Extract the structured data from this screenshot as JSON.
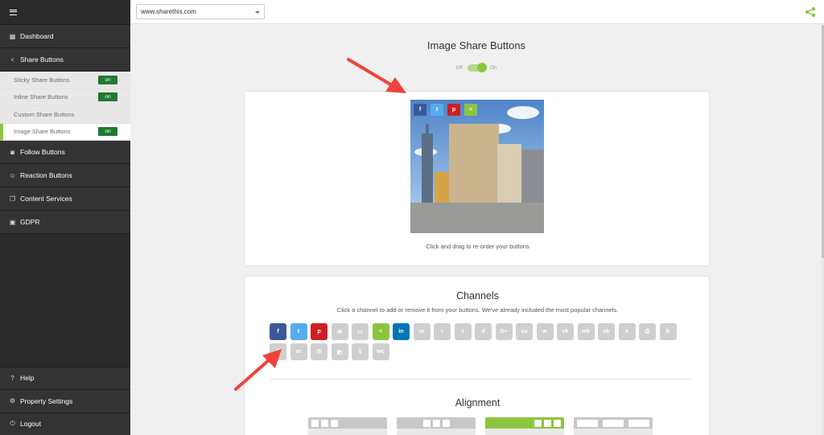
{
  "sidebar": {
    "menu_icon": "hamburger-icon",
    "items": [
      {
        "icon": "grid-icon",
        "label": "Dashboard"
      },
      {
        "icon": "share-icon",
        "label": "Share Buttons"
      }
    ],
    "sub_items": [
      {
        "label": "Sticky Share Buttons",
        "badge": "on"
      },
      {
        "label": "Inline Share Buttons",
        "badge": "on"
      },
      {
        "label": "Custom Share Buttons",
        "badge": ""
      },
      {
        "label": "Image Share Buttons",
        "badge": "on"
      }
    ],
    "items_after": [
      {
        "icon": "rss-icon",
        "label": "Follow Buttons"
      },
      {
        "icon": "smiley-icon",
        "label": "Reaction Buttons"
      },
      {
        "icon": "copy-icon",
        "label": "Content Services"
      },
      {
        "icon": "lock-icon",
        "label": "GDPR"
      }
    ],
    "bottom": [
      {
        "icon": "help-icon",
        "label": "Help"
      },
      {
        "icon": "gear-icon",
        "label": "Property Settings"
      },
      {
        "icon": "power-icon",
        "label": "Logout"
      }
    ]
  },
  "topbar": {
    "domain": "www.sharethis.com",
    "share_icon": "share-icon"
  },
  "main": {
    "title": "Image Share Buttons",
    "toggle": {
      "off_label": "Off",
      "on_label": "On",
      "state": "on"
    },
    "preview": {
      "buttons": [
        {
          "icon": "facebook-icon",
          "glyph": "f",
          "color": "#3b5998"
        },
        {
          "icon": "twitter-icon",
          "glyph": "t",
          "color": "#55acee"
        },
        {
          "icon": "pinterest-icon",
          "glyph": "p",
          "color": "#cb2027"
        },
        {
          "icon": "sharethis-icon",
          "glyph": "<",
          "color": "#8bc53f"
        }
      ],
      "caption": "Click and drag to re-order your buttons"
    },
    "channels": {
      "title": "Channels",
      "subtitle": "Click a channel to add or remove it from your buttons. We've already included the most popular channels.",
      "items": [
        {
          "icon": "facebook-icon",
          "glyph": "f",
          "color": "#3b5998",
          "selected": true
        },
        {
          "icon": "twitter-icon",
          "glyph": "t",
          "color": "#55acee",
          "selected": true
        },
        {
          "icon": "pinterest-icon",
          "glyph": "p",
          "color": "#cb2027",
          "selected": true
        },
        {
          "icon": "email-icon",
          "glyph": "✉",
          "color": "#cfcfcf",
          "selected": false
        },
        {
          "icon": "sms-icon",
          "glyph": "▭",
          "color": "#cfcfcf",
          "selected": false
        },
        {
          "icon": "sharethis-icon",
          "glyph": "<",
          "color": "#8bc53f",
          "selected": true
        },
        {
          "icon": "linkedin-icon",
          "glyph": "in",
          "color": "#0077b5",
          "selected": true
        },
        {
          "icon": "messenger-icon",
          "glyph": "m",
          "color": "#cfcfcf",
          "selected": false
        },
        {
          "icon": "reddit-icon",
          "glyph": "r",
          "color": "#cfcfcf",
          "selected": false
        },
        {
          "icon": "tumblr-icon",
          "glyph": "t",
          "color": "#cfcfcf",
          "selected": false
        },
        {
          "icon": "digg-icon",
          "glyph": "d",
          "color": "#cfcfcf",
          "selected": false
        },
        {
          "icon": "googleplus-icon",
          "glyph": "G+",
          "color": "#cfcfcf",
          "selected": false
        },
        {
          "icon": "stumbleupon-icon",
          "glyph": "su",
          "color": "#cfcfcf",
          "selected": false
        },
        {
          "icon": "whatsapp-icon",
          "glyph": "w",
          "color": "#cfcfcf",
          "selected": false
        },
        {
          "icon": "vk-icon",
          "glyph": "vk",
          "color": "#cfcfcf",
          "selected": false
        },
        {
          "icon": "weibo-icon",
          "glyph": "wb",
          "color": "#cfcfcf",
          "selected": false
        },
        {
          "icon": "odnoklassniki-icon",
          "glyph": "ok",
          "color": "#cfcfcf",
          "selected": false
        },
        {
          "icon": "xing-icon",
          "glyph": "x",
          "color": "#cfcfcf",
          "selected": false
        },
        {
          "icon": "print-icon",
          "glyph": "⎙",
          "color": "#cfcfcf",
          "selected": false
        },
        {
          "icon": "blogger-icon",
          "glyph": "b",
          "color": "#cfcfcf",
          "selected": false
        },
        {
          "icon": "flipboard-icon",
          "glyph": "F",
          "color": "#cfcfcf",
          "selected": false
        },
        {
          "icon": "meneame-icon",
          "glyph": "m",
          "color": "#cfcfcf",
          "selected": false
        },
        {
          "icon": "mailru-icon",
          "glyph": "@",
          "color": "#cfcfcf",
          "selected": false
        },
        {
          "icon": "delicious-icon",
          "glyph": "◩",
          "color": "#cfcfcf",
          "selected": false
        },
        {
          "icon": "livejournal-icon",
          "glyph": "lj",
          "color": "#cfcfcf",
          "selected": false
        },
        {
          "icon": "wechat-icon",
          "glyph": "wc",
          "color": "#cfcfcf",
          "selected": false
        }
      ]
    },
    "alignment": {
      "title": "Alignment",
      "options": [
        {
          "name": "left",
          "selected": false
        },
        {
          "name": "center",
          "selected": false
        },
        {
          "name": "right",
          "selected": true
        },
        {
          "name": "justified",
          "selected": false
        }
      ]
    }
  },
  "colors": {
    "accent": "#8bc53f",
    "sidebar": "#2b2b2b",
    "badge": "#1f7a2f",
    "arrow": "#f0423a"
  }
}
